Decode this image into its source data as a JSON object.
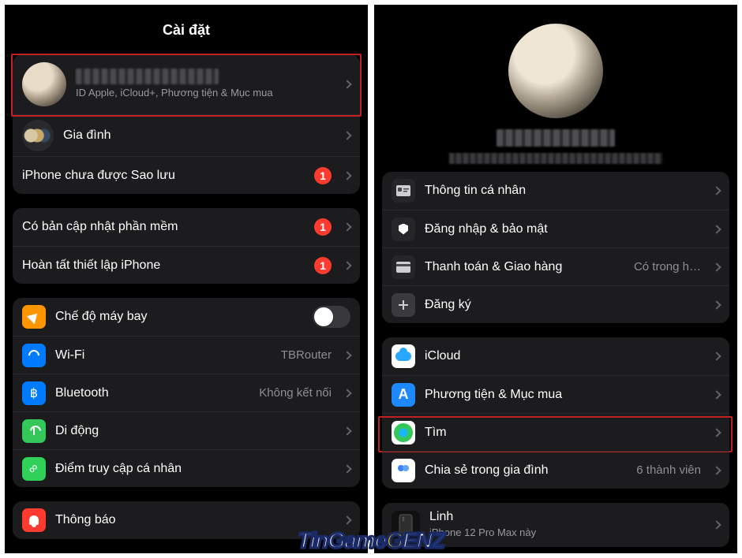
{
  "left": {
    "title": "Cài đặt",
    "profile_sub": "ID Apple, iCloud+, Phương tiện & Mục mua",
    "family_label": "Gia đình",
    "backup_warn": "iPhone chưa được Sao lưu",
    "badge1": "1",
    "update_label": "Có bản cập nhật phần mềm",
    "badge2": "1",
    "finish_label": "Hoàn tất thiết lập iPhone",
    "badge3": "1",
    "airplane": "Chế độ máy bay",
    "wifi": "Wi-Fi",
    "wifi_value": "TBRouter",
    "bluetooth": "Bluetooth",
    "bluetooth_value": "Không kết nối",
    "cellular": "Di động",
    "hotspot": "Điểm truy cập cá nhân",
    "notifications": "Thông báo"
  },
  "right": {
    "personal": "Thông tin cá nhân",
    "signin": "Đăng nhập & bảo mật",
    "payment": "Thanh toán & Giao hàng",
    "payment_value": "Có trong h…",
    "subscriptions": "Đăng ký",
    "icloud": "iCloud",
    "media": "Phương tiện & Mục mua",
    "find": "Tìm",
    "family": "Chia sẻ trong gia đình",
    "family_value": "6 thành viên",
    "device_name": "Linh",
    "device_model": "iPhone 12 Pro Max này"
  },
  "watermark": {
    "a": "TinGame",
    "b": "G",
    "c": "EN",
    "d": "Z"
  }
}
